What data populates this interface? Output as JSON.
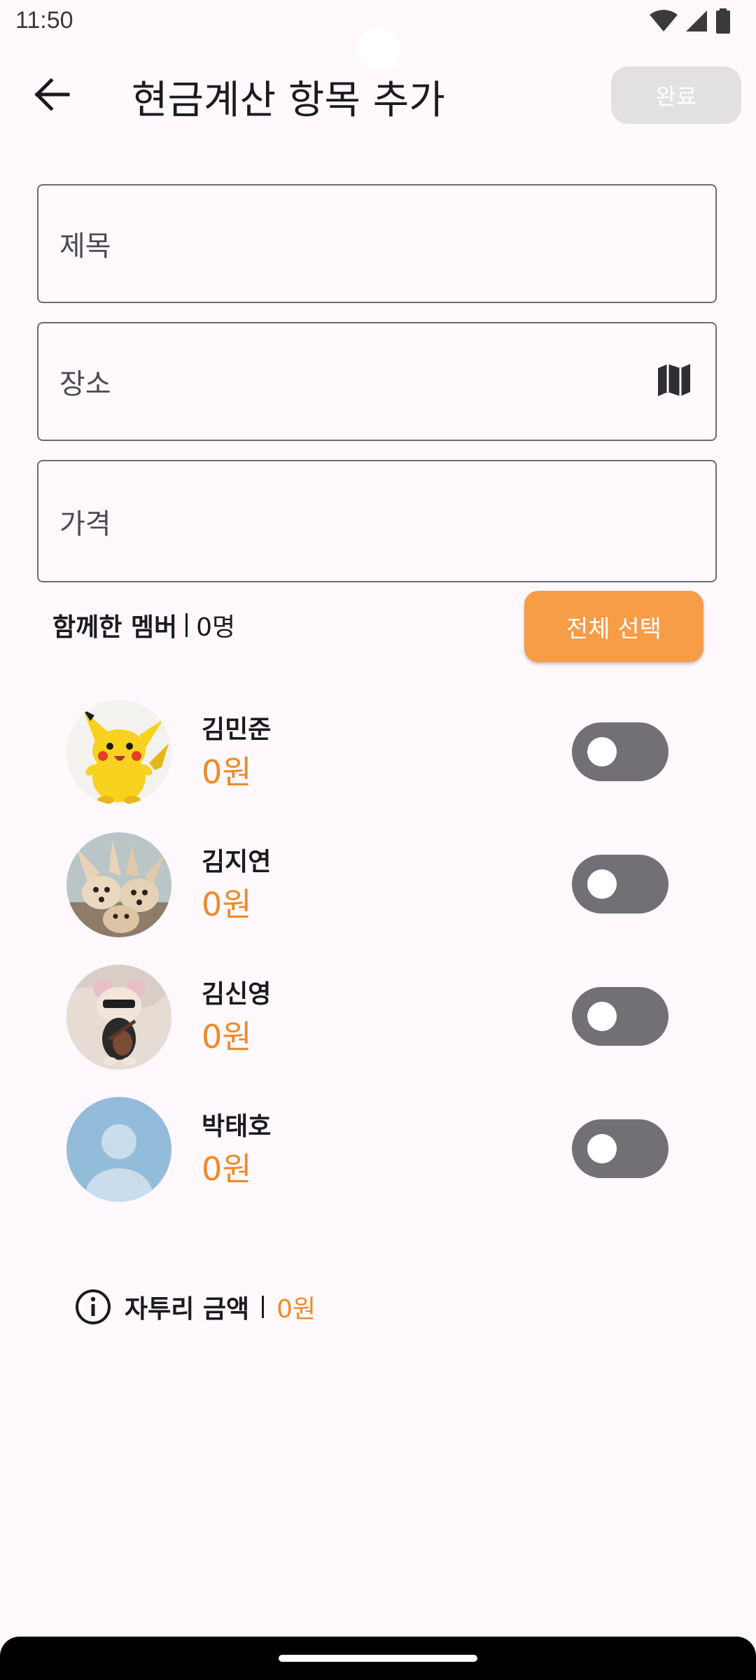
{
  "status_bar": {
    "time": "11:50",
    "icons": [
      "wifi-icon",
      "cell-signal-icon",
      "battery-icon"
    ]
  },
  "app_bar": {
    "title": "현금계산 항목 추가",
    "done_label": "완료",
    "back_icon": "arrow-back-icon"
  },
  "form": {
    "title_placeholder": "제목",
    "place_placeholder": "장소",
    "place_icon": "map-icon",
    "price_placeholder": "가격"
  },
  "members_header": {
    "label": "함께한 멤버",
    "count": "0명",
    "select_all_label": "전체 선택"
  },
  "members": [
    {
      "name": "김민준",
      "amount": "0원",
      "avatar": "pikachu",
      "enabled": false
    },
    {
      "name": "김지연",
      "amount": "0원",
      "avatar": "fennec-foxes",
      "enabled": false
    },
    {
      "name": "김신영",
      "amount": "0원",
      "avatar": "plush-toy-guitar",
      "enabled": false
    },
    {
      "name": "박태호",
      "amount": "0원",
      "avatar": "default-person",
      "enabled": false
    }
  ],
  "remainder": {
    "label": "자투리 금액",
    "amount": "0원",
    "icon": "info-icon"
  },
  "colors": {
    "accent": "#F79D48",
    "amount_text": "#EF8A27",
    "background": "#FFF8FC",
    "toggle_off": "#737075",
    "done_disabled": "#E3E0E4"
  }
}
